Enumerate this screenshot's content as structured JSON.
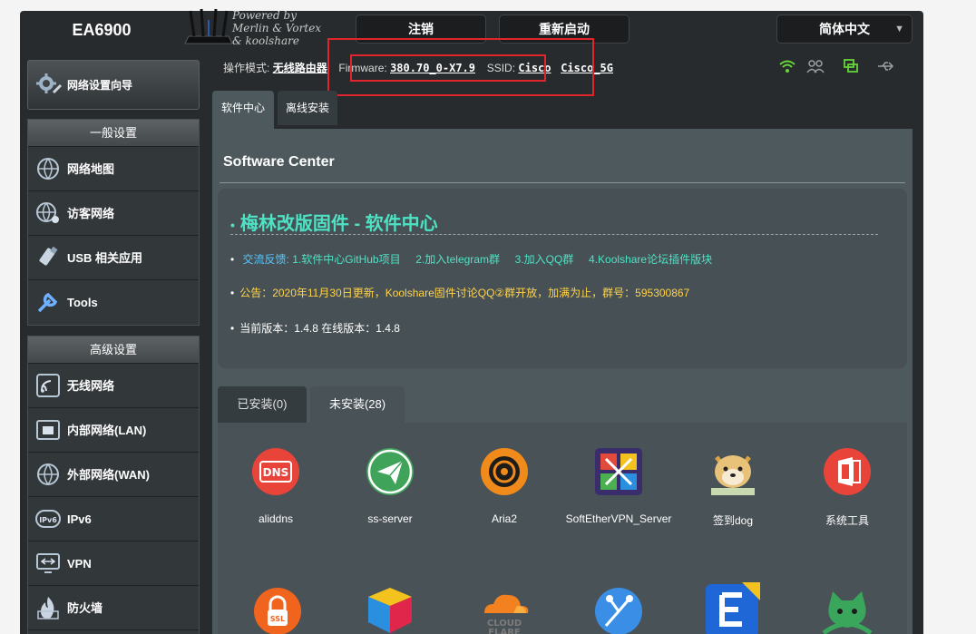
{
  "header": {
    "model": "EA6900",
    "powered": [
      "Powered by",
      "Merlin & Vortex",
      "& koolshare"
    ],
    "logout": "注销",
    "reboot": "重新启动",
    "language": "简体中文"
  },
  "status": {
    "mode_label": "操作模式:",
    "mode_value": "无线路由器",
    "firmware_label": "Firmware:",
    "firmware_value": "380.70_0-X7.9",
    "ssid_label": "SSID:",
    "ssid_1": "Cisco",
    "ssid_2": "Cisco_5G"
  },
  "sidebar": {
    "wizard": "网络设置向导",
    "general_title": "一般设置",
    "general_items": [
      "网络地图",
      "访客网络",
      "USB 相关应用",
      "Tools"
    ],
    "advanced_title": "高级设置",
    "advanced_items": [
      "无线网络",
      "内部网络(LAN)",
      "外部网络(WAN)",
      "IPv6",
      "VPN",
      "防火墙"
    ]
  },
  "tabs": [
    "软件中心",
    "离线安装"
  ],
  "page": {
    "title": "Software Center",
    "heading": "梅林改版固件 - 软件中心",
    "feedback_label": "交流反馈:",
    "feedback_links": [
      "1.软件中心GitHub项目",
      "2.加入telegram群",
      "3.加入QQ群",
      "4.Koolshare论坛插件版块"
    ],
    "notice": "公告：2020年11月30日更新，Koolshare固件讨论QQ②群开放，加满为止，群号：595300867",
    "version": "当前版本：1.4.8 在线版本：1.4.8"
  },
  "subtabs": [
    "已安装(0)",
    "未安装(28)"
  ],
  "apps": [
    "aliddns",
    "ss-server",
    "Aria2",
    "SoftEtherVPN_Server",
    "签到dog",
    "系统工具"
  ],
  "colors": {
    "accent": "#4ee2c4",
    "notice": "#ffd24a",
    "highlight": "#e0262c"
  }
}
